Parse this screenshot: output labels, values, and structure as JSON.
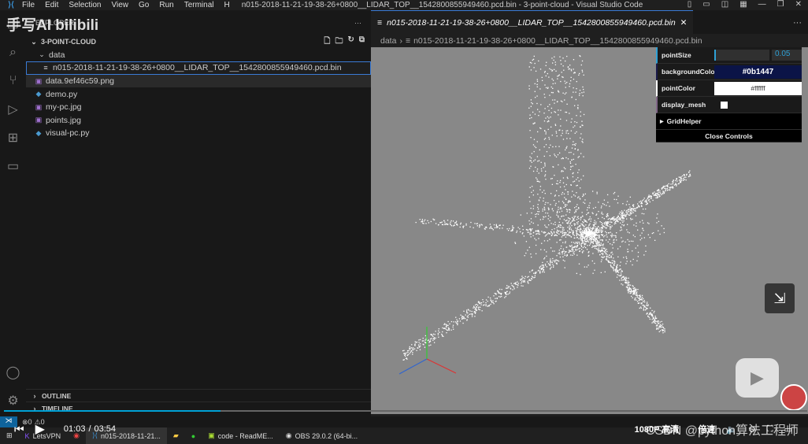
{
  "titlebar": {
    "menu": [
      "File",
      "Edit",
      "Selection",
      "View",
      "Go",
      "Run",
      "Terminal",
      "H"
    ],
    "title": "n015-2018-11-21-19-38-26+0800__LIDAR_TOP__1542800855949460.pcd.bin - 3-point-cloud - Visual Studio Code"
  },
  "sidebar": {
    "header": "EXPLORER",
    "project": "3-POINT-CLOUD",
    "files": [
      {
        "name": "data",
        "type": "folder"
      },
      {
        "name": "n015-2018-11-21-19-38-26+0800__LIDAR_TOP__1542800855949460.pcd.bin",
        "type": "file"
      },
      {
        "name": "data.9ef46c59.png",
        "type": "image"
      },
      {
        "name": "demo.py",
        "type": "python"
      },
      {
        "name": "my-pc.jpg",
        "type": "image"
      },
      {
        "name": "points.jpg",
        "type": "image"
      },
      {
        "name": "visual-pc.py",
        "type": "python"
      }
    ],
    "outline": "OUTLINE",
    "timeline": "TIMELINE"
  },
  "editor": {
    "tab": "n015-2018-11-21-19-38-26+0800__LIDAR_TOP__1542800855949460.pcd.bin",
    "breadcrumb": [
      "data",
      "n015-2018-11-21-19-38-26+0800__LIDAR_TOP__1542800855949460.pcd.bin"
    ]
  },
  "controls": {
    "pointSize_label": "pointSize",
    "pointSize": "0.05",
    "backgroundColor_label": "backgroundColor",
    "backgroundColor": "#0b1447",
    "pointColor_label": "pointColor",
    "pointColor": "#ffffff",
    "display_mesh_label": "display_mesh",
    "display_mesh": false,
    "grid": "GridHelper",
    "close": "Close Controls"
  },
  "status": {
    "errors": "0",
    "warnings": "0"
  },
  "player": {
    "current": "01:03",
    "duration": "03:54",
    "progress": 0.27,
    "quality": "1080P 高清",
    "speed": "倍速"
  },
  "taskbar": [
    "LetsVPN",
    "n015-2018-11-21...",
    "code - ReadME...",
    "OBS 29.0.2 (64-bi..."
  ],
  "watermark": {
    "left": "手写AI bilibili",
    "right": "CSDN @python算法工程师"
  }
}
